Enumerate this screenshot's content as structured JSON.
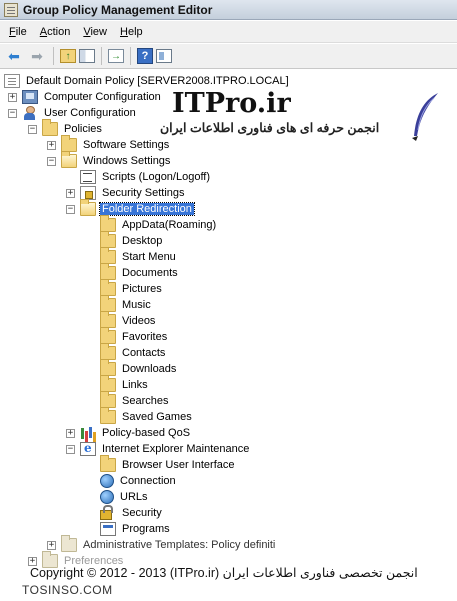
{
  "window": {
    "title": "Group Policy Management Editor"
  },
  "menu": [
    {
      "label": "File",
      "mnemonic": "F",
      "rest": "ile"
    },
    {
      "label": "Action",
      "mnemonic": "A",
      "rest": "ction"
    },
    {
      "label": "View",
      "mnemonic": "V",
      "rest": "iew"
    },
    {
      "label": "Help",
      "mnemonic": "H",
      "rest": "elp"
    }
  ],
  "toolbar": {
    "back_icon": "arrow-left-icon",
    "forward_icon": "arrow-right-icon",
    "up_icon": "up-folder-icon",
    "pane_icon": "show-hide-console-tree-icon",
    "export_icon": "export-list-icon",
    "help_icon": "help-icon",
    "help_glyph": "?",
    "properties_icon": "properties-icon"
  },
  "tree": {
    "root": "Default Domain Policy [SERVER2008.ITPRO.LOCAL]",
    "computer_config": "Computer Configuration",
    "user_config": "User Configuration",
    "policies": "Policies",
    "software_settings": "Software Settings",
    "windows_settings": "Windows Settings",
    "scripts": "Scripts (Logon/Logoff)",
    "security_settings": "Security Settings",
    "folder_redirection": "Folder Redirection",
    "redirected_folders": [
      "AppData(Roaming)",
      "Desktop",
      "Start Menu",
      "Documents",
      "Pictures",
      "Music",
      "Videos",
      "Favorites",
      "Contacts",
      "Downloads",
      "Links",
      "Searches",
      "Saved Games"
    ],
    "qos": "Policy-based QoS",
    "ie_maintenance": "Internet Explorer Maintenance",
    "ie_items": [
      "Browser User Interface",
      "Connection",
      "URLs",
      "Security",
      "Programs"
    ],
    "admin_templates": "Administrative Templates: Policy definiti",
    "preferences": "Preferences"
  },
  "watermark": {
    "brand": "ITPro.ir",
    "tagline": "انجمن حرفه ای های فناوری اطلاعات ایران",
    "copyright": "Copyright © 2012 - 2013 (ITPro.ir) انجمن تخصصی فناوری اطلاعات ایران",
    "site": "TOSINSO.COM"
  },
  "colors": {
    "selection": "#3875d7",
    "folder": "#f2d37a"
  }
}
